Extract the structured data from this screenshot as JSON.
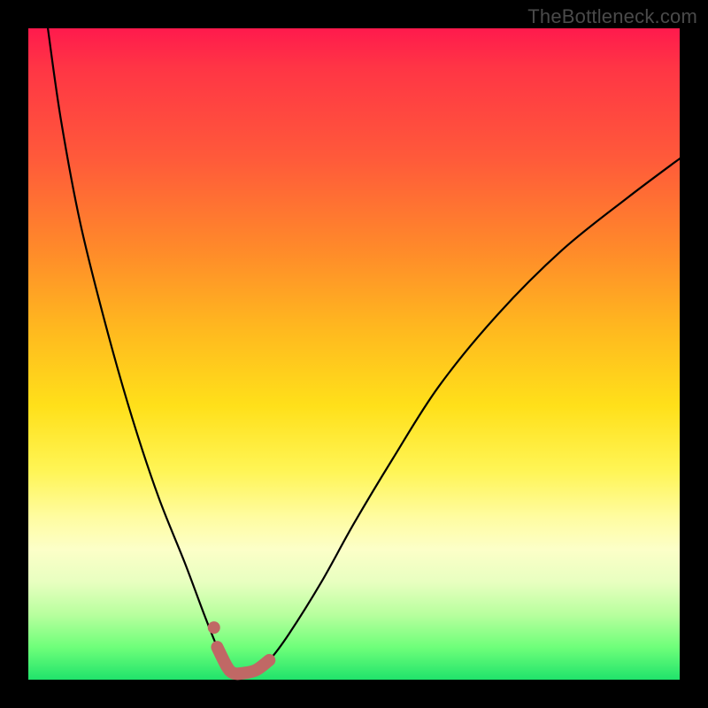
{
  "watermark": "TheBottleneck.com",
  "chart_data": {
    "type": "line",
    "title": "",
    "xlabel": "",
    "ylabel": "",
    "xlim": [
      0,
      100
    ],
    "ylim": [
      0,
      100
    ],
    "grid": false,
    "series": [
      {
        "name": "bottleneck-curve",
        "x": [
          3,
          5,
          8,
          12,
          16,
          20,
          24,
          27,
          29,
          30.5,
          31.5,
          33,
          35,
          37,
          40,
          45,
          50,
          56,
          63,
          72,
          82,
          92,
          100
        ],
        "values": [
          100,
          86,
          70,
          54,
          40,
          28,
          18,
          10,
          5,
          2,
          1,
          1,
          1.5,
          3,
          7,
          15,
          24,
          34,
          45,
          56,
          66,
          74,
          80
        ]
      }
    ],
    "highlight_segments": [
      {
        "name": "near-minimum-band",
        "x": [
          29,
          30.5,
          31.5,
          33,
          35,
          37
        ],
        "values": [
          5,
          2,
          1,
          1,
          1.5,
          3
        ]
      }
    ],
    "highlight_points": [
      {
        "name": "left-dot",
        "x": 28.5,
        "value": 8
      }
    ],
    "background_gradient_stops": [
      {
        "position": 0,
        "color": "#ff1a4d"
      },
      {
        "position": 46,
        "color": "#ffb81f"
      },
      {
        "position": 68,
        "color": "#fff556"
      },
      {
        "position": 100,
        "color": "#20e36b"
      }
    ]
  }
}
